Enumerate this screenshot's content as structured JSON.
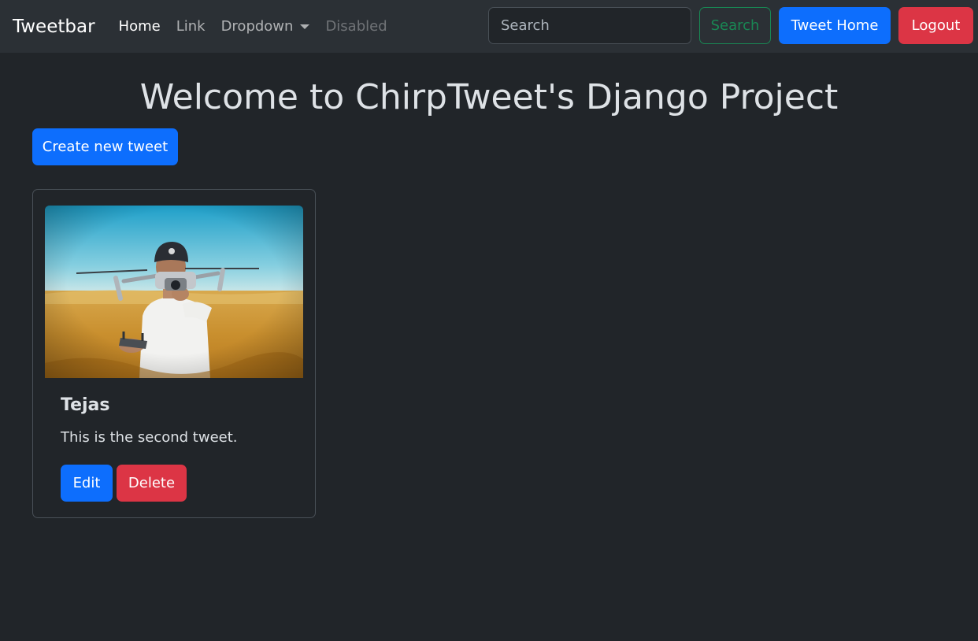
{
  "navbar": {
    "brand": "Tweetbar",
    "links": [
      {
        "label": "Home"
      },
      {
        "label": "Link"
      },
      {
        "label": "Dropdown"
      },
      {
        "label": "Disabled"
      }
    ],
    "search_placeholder": "Search",
    "search_button": "Search",
    "tweet_home_button": "Tweet Home",
    "logout_button": "Logout"
  },
  "main": {
    "title": "Welcome to ChirpTweet's Django Project",
    "create_button": "Create new tweet"
  },
  "tweets": [
    {
      "author": "Tejas",
      "text": "This is the second tweet.",
      "edit_label": "Edit",
      "delete_label": "Delete"
    }
  ],
  "colors": {
    "background": "#212529",
    "navbar": "#2b3035",
    "primary": "#0d6efd",
    "danger": "#dc3545",
    "success": "#198754"
  }
}
